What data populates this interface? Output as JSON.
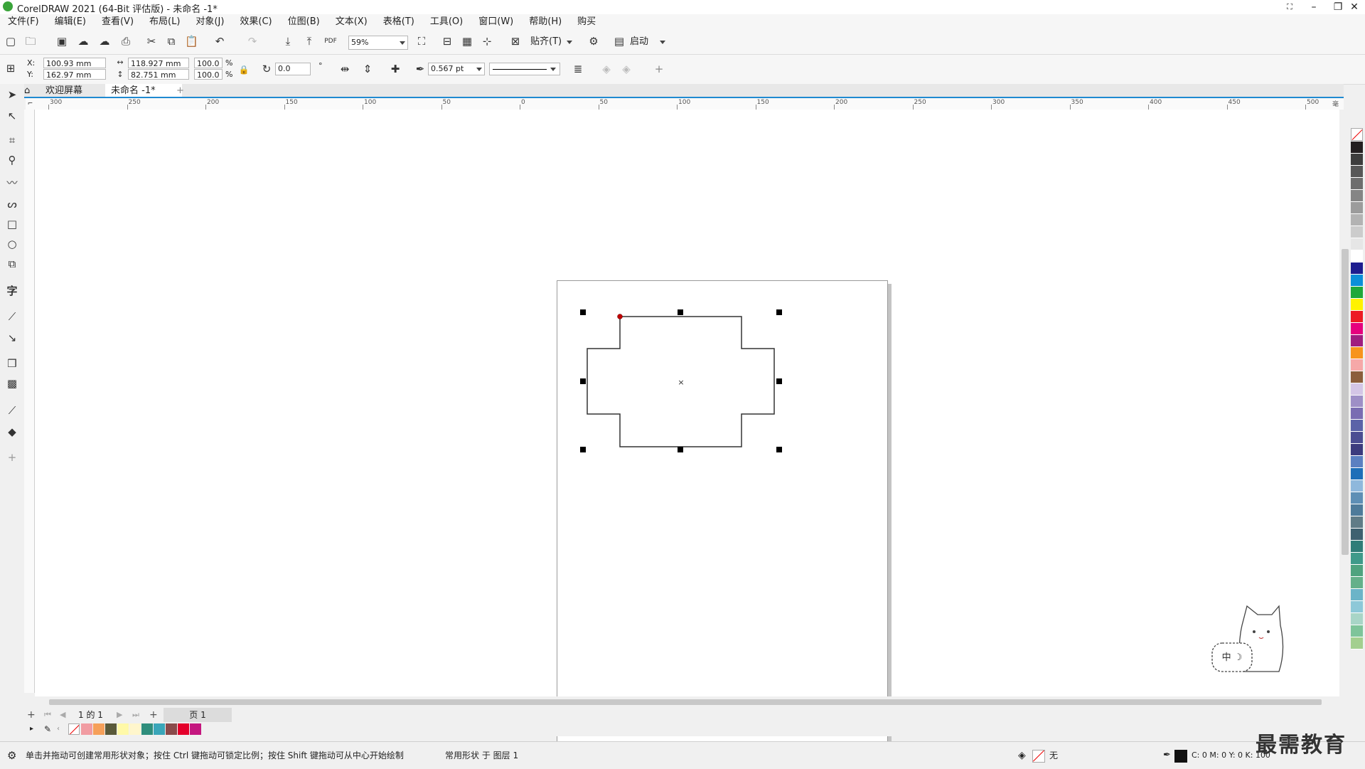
{
  "window": {
    "title": "CorelDRAW 2021 (64-Bit 评估版) - 未命名 -1*",
    "minimize": "–",
    "restore": "❐",
    "close": "✕"
  },
  "menu": [
    "文件(F)",
    "编辑(E)",
    "查看(V)",
    "布局(L)",
    "对象(J)",
    "效果(C)",
    "位图(B)",
    "文本(X)",
    "表格(T)",
    "工具(O)",
    "窗口(W)",
    "帮助(H)",
    "购买"
  ],
  "toolbar": {
    "zoom_value": "59%",
    "snap_label": "贴齐(T)",
    "launch_label": "启动"
  },
  "propbar": {
    "x_label": "X:",
    "y_label": "Y:",
    "x_value": "100.93 mm",
    "y_value": "162.97 mm",
    "w_value": "118.927 mm",
    "h_value": "82.751 mm",
    "w_pct": "100.0",
    "h_pct": "100.0",
    "pct": "%",
    "rotation": "0.0",
    "outline_width": "0.567 pt"
  },
  "tabs": {
    "welcome": "欢迎屏幕",
    "doc": "未命名 -1*",
    "add": "+"
  },
  "ruler_h_labels": [
    "300",
    "250",
    "200",
    "150",
    "100",
    "50",
    "0",
    "50",
    "100",
    "150",
    "200",
    "250",
    "300",
    "350",
    "400",
    "450",
    "500"
  ],
  "ruler_h_unit": "毫米",
  "pagenav": {
    "page_info": "1 的 1",
    "page_tab": "页 1"
  },
  "status": {
    "hint": "单击并拖动可创建常用形状对象；按住 Ctrl 键拖动可锁定比例；按住 Shift 键拖动可从中心开始绘制",
    "object_info": "常用形状 于 图层 1",
    "fill_none": "无",
    "cmyk": "C: 0 M: 0 Y: 0 K: 100"
  },
  "watermark": "最需教育",
  "sticker_text": "中 ☽",
  "palette_colors": [
    "#231f20",
    "#3d3d3d",
    "#575757",
    "#6e6e6e",
    "#858585",
    "#9c9c9c",
    "#b3b3b3",
    "#cccccc",
    "#e6e6e6",
    "#ffffff",
    "#1d1d8f",
    "#0b8fd8",
    "#1fa83a",
    "#fff200",
    "#ed1c24",
    "#e6007e",
    "#a01d7f",
    "#f7941d",
    "#f6a8a8",
    "#8b5e3c",
    "#d4c6e6",
    "#9e8fc6",
    "#7a6db2",
    "#5b63a8",
    "#4b4d92",
    "#3c3b7e",
    "#5b80c1",
    "#1e6fb8",
    "#8fb8dc",
    "#5e8fb5",
    "#4e7b9a",
    "#607c87",
    "#3e6170",
    "#2f7d78",
    "#3f9a8a",
    "#4fa37f",
    "#64b08a",
    "#6bb4c8",
    "#8dc8d8",
    "#a8d5c7",
    "#7ec49a",
    "#a3cf8f"
  ],
  "bottom_palette": [
    "#f19ca2",
    "#f6a05a",
    "#5a5a3a",
    "#fff9a8",
    "#fff6cc",
    "#2f8e7c",
    "#3aa6b9",
    "#8a4b4b",
    "#e4002b",
    "#c4177f"
  ],
  "colors": {
    "accent": "#1f8ad1",
    "red_node": "#c00000"
  }
}
